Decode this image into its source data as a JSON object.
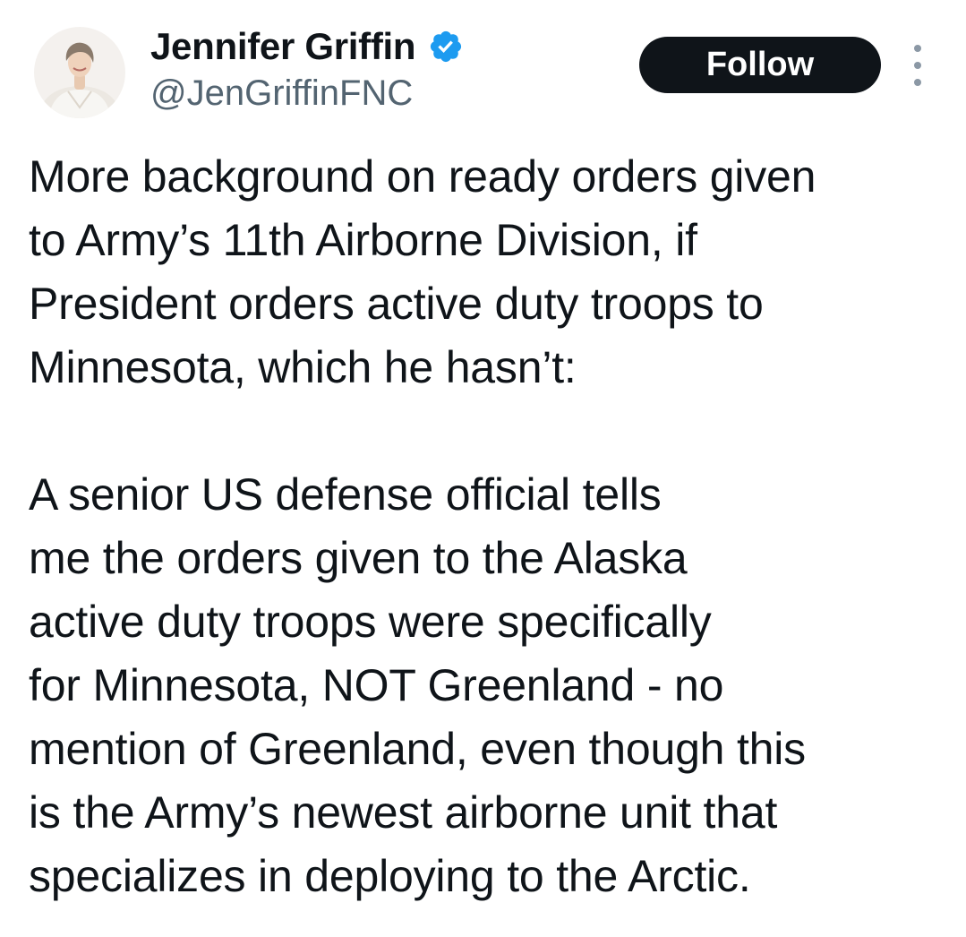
{
  "author": {
    "name": "Jennifer Griffin",
    "handle": "@JenGriffinFNC",
    "verified": true,
    "verified_color": "#1d9bf0"
  },
  "follow_button": {
    "label": "Follow",
    "background": "#0f1419",
    "text_color": "#ffffff"
  },
  "more_menu": {
    "icon": "more-vertical-icon"
  },
  "tweet": {
    "paragraph_1": [
      "More background on ready orders given",
      "to Army’s 11th Airborne Division, if",
      "President orders active duty troops to",
      "Minnesota, which he hasn’t:"
    ],
    "paragraph_2": [
      "A senior US defense official tells",
      "me the orders given to the Alaska",
      "active duty troops were specifically",
      "for Minnesota, NOT Greenland - no",
      "mention of Greenland, even though this",
      "is the Army’s newest airborne unit that",
      "specializes in deploying to the Arctic."
    ]
  }
}
